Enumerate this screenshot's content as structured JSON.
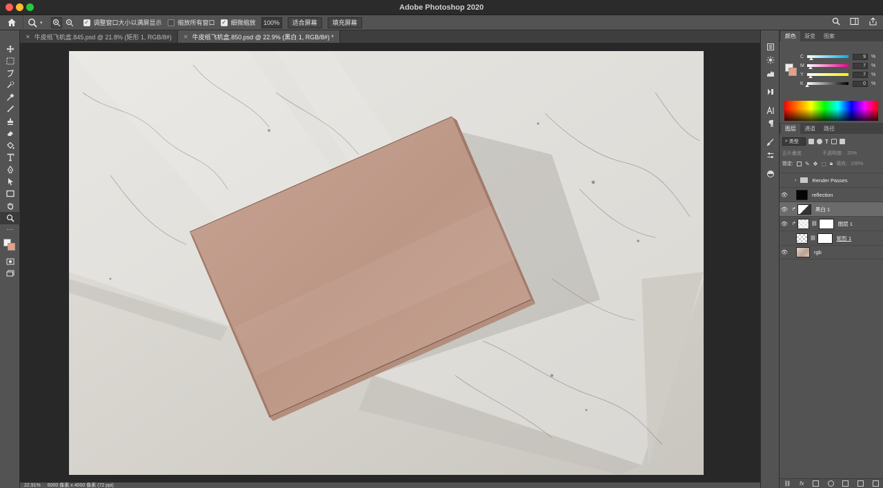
{
  "app": {
    "title": "Adobe Photoshop 2020"
  },
  "options": {
    "fit_label": "调整窗口大小以满屏显示",
    "zoom_all_label": "缩放所有窗口",
    "scrubby_label": "细微缩放",
    "zoom_value": "100%",
    "fit_screen": "适合屏幕",
    "fill_screen": "填充屏幕"
  },
  "tabs": [
    {
      "label": "牛皮纸飞机盒.845.psd @ 21.8% (矩形 1, RGB/8#)"
    },
    {
      "label": "牛皮纸飞机盒.850.psd @ 22.9% (黑白 1, RGB/8#) *"
    }
  ],
  "status": {
    "zoom": "22.91%",
    "doc_size": "6000 像素 x 4000 像素 (72 ppi)"
  },
  "color_panel": {
    "tabs": [
      "颜色",
      "渐变",
      "图案"
    ],
    "sliders": [
      {
        "label": "C",
        "value": "9",
        "gradient": "linear-gradient(to right,#ffffff,#00aeef)"
      },
      {
        "label": "M",
        "value": "7",
        "gradient": "linear-gradient(to right,#ffffff,#ec008c)"
      },
      {
        "label": "Y",
        "value": "7",
        "gradient": "linear-gradient(to right,#ffffff,#fff200)"
      },
      {
        "label": "K",
        "value": "0",
        "gradient": "linear-gradient(to right,#ffffff,#000000)"
      }
    ],
    "percent": "%",
    "fg_color": "#eeeeee",
    "bg_color": "#e8a07f"
  },
  "layers_panel": {
    "tabs": [
      "图层",
      "通道",
      "路径"
    ],
    "filter_label": "类型",
    "blend_mode": "正片叠底",
    "opacity_label": "不透明度:",
    "opacity_value": "20%",
    "lock_label": "锁定:",
    "fill_label": "填充:",
    "fill_value": "100%",
    "layers": [
      {
        "name": "Render Passes",
        "kind": "group",
        "visible": false
      },
      {
        "name": "reflection",
        "kind": "black",
        "visible": true
      },
      {
        "name": "黑白 1",
        "kind": "adjustment",
        "visible": true,
        "selected": true
      },
      {
        "name": "图层 1",
        "kind": "masked",
        "visible": true
      },
      {
        "name": "矩形 1",
        "kind": "shape",
        "visible": false
      },
      {
        "name": "rgb",
        "kind": "photo",
        "visible": true
      }
    ]
  }
}
